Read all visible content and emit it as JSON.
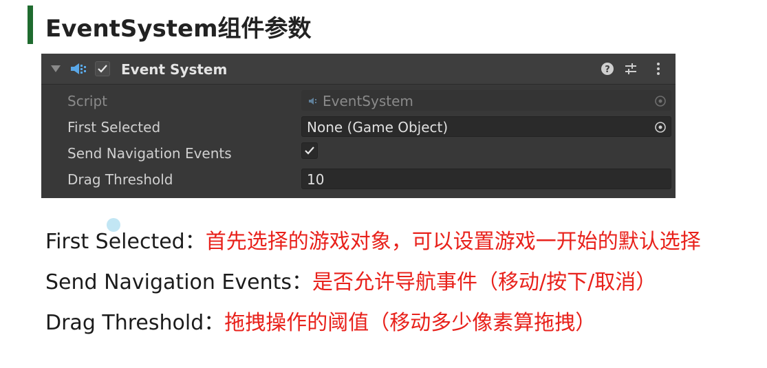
{
  "slide": {
    "title": "EventSystem组件参数"
  },
  "component": {
    "name": "Event System",
    "enabled": true,
    "header_buttons": [
      "help-icon",
      "presets-icon",
      "kebab-menu-icon"
    ],
    "properties": [
      {
        "label": "Script",
        "value": "EventSystem",
        "icon": "script-icon",
        "disabled": true
      },
      {
        "label": "First Selected",
        "value": "None (Game Object)"
      },
      {
        "label": "Send Navigation Events",
        "checked": true
      },
      {
        "label": "Drag Threshold",
        "value": "10"
      }
    ]
  },
  "descriptions": [
    {
      "term": "First Selected",
      "sep": "：",
      "text": "首先选择的游戏对象，可以设置游戏一开始的默认选择"
    },
    {
      "term": "Send Navigation Events",
      "sep": "：",
      "text": "是否允许导航事件（移动/按下/取消）"
    },
    {
      "term": "Drag Threshold",
      "sep": "：",
      "text": "拖拽操作的阈值（移动多少像素算拖拽）"
    }
  ],
  "colors": {
    "accent_bar": "#1f6b2f",
    "explanation_text": "#e8211b",
    "panel_bg": "#383838"
  }
}
